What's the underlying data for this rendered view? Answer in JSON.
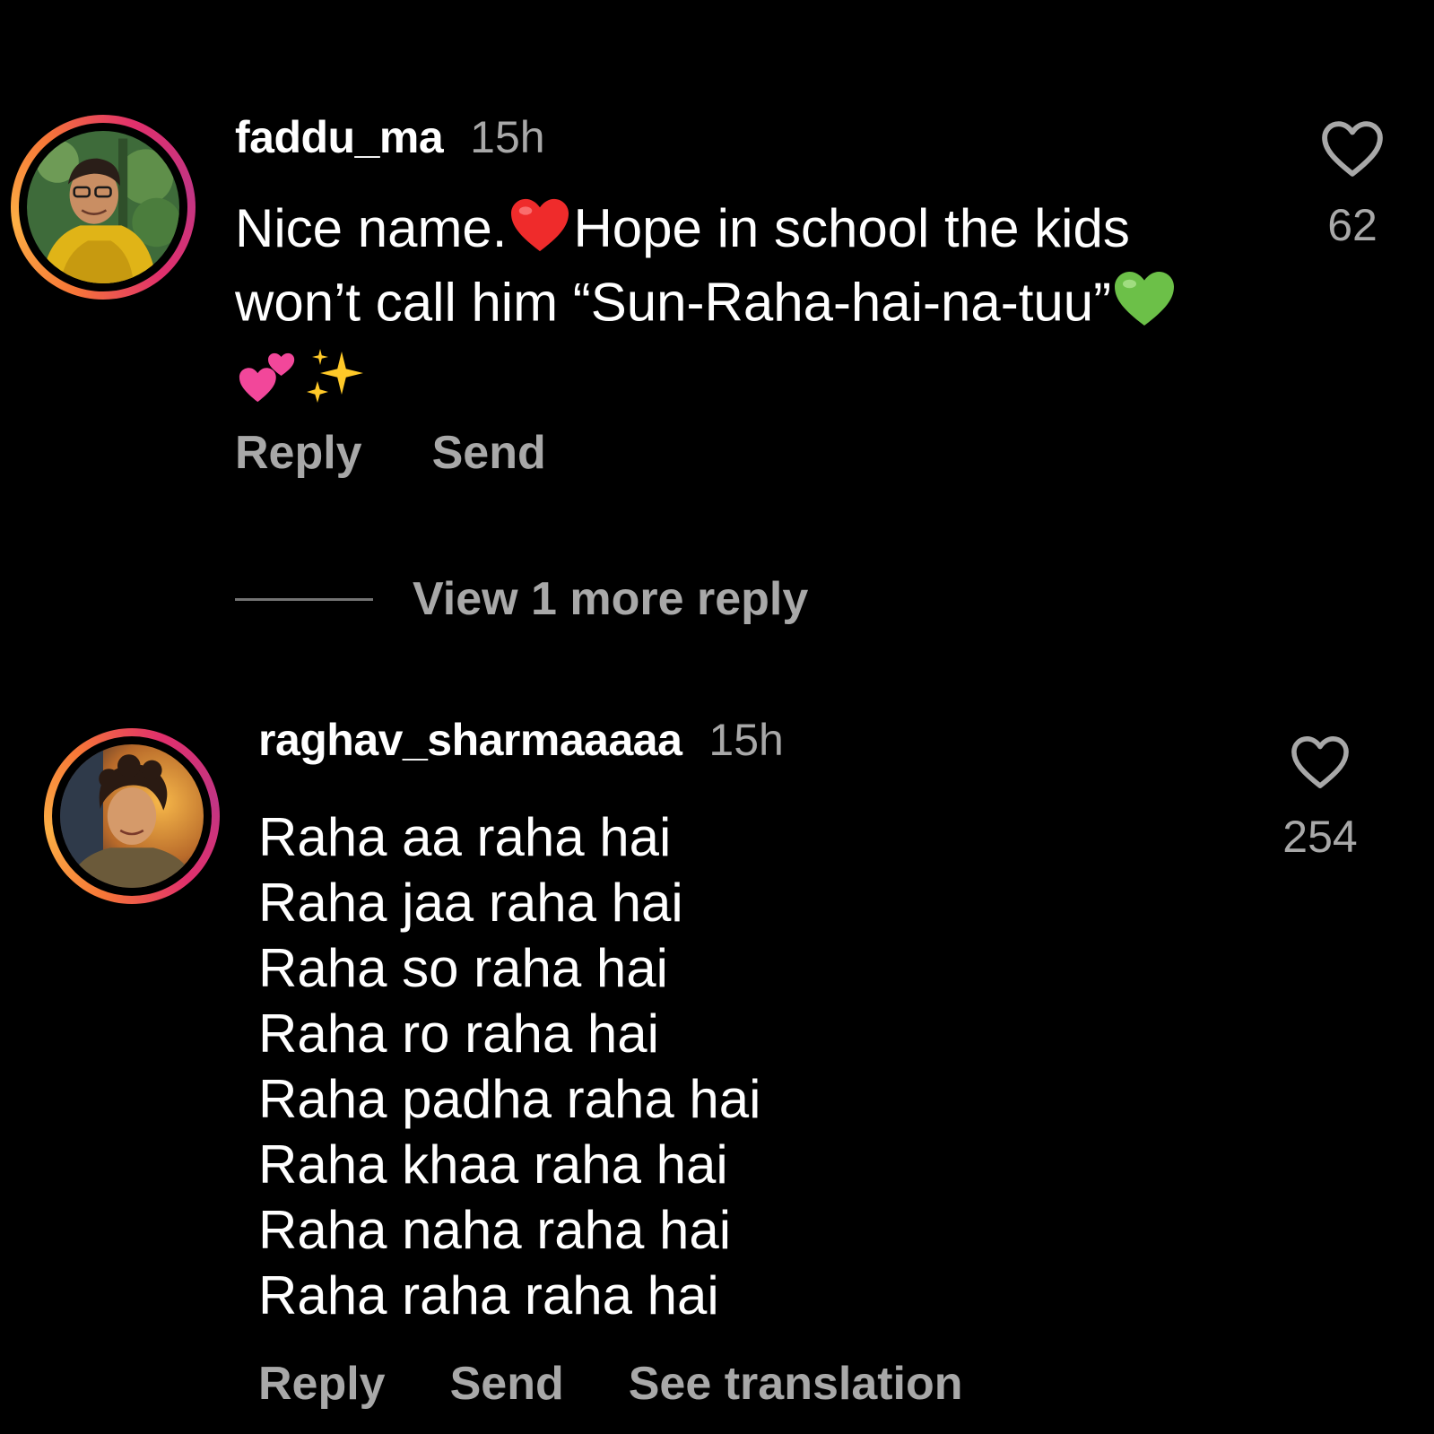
{
  "comments": [
    {
      "username": "faddu_ma",
      "time": "15h",
      "body_lines": [
        {
          "before": "Nice name.",
          "after": "Hope in school the kids"
        },
        "won’t call him “Sun-Raha-hai-na-tuu”"
      ],
      "emojis": [
        "red-heart",
        "green-heart",
        "two-hearts",
        "sparkles"
      ],
      "likes": "62",
      "actions": {
        "reply": "Reply",
        "send": "Send"
      }
    },
    {
      "username": "raghav_sharmaaaaa",
      "time": "15h",
      "body_lines": [
        "Raha aa raha hai",
        "Raha jaa raha hai",
        "Raha so raha hai",
        "Raha ro raha hai",
        "Raha padha raha hai",
        "Raha khaa raha hai",
        "Raha naha raha hai",
        "Raha raha raha hai"
      ],
      "likes": "254",
      "actions": {
        "reply": "Reply",
        "send": "Send",
        "translate": "See translation"
      }
    }
  ],
  "view_more_replies": "View 1 more reply",
  "colors": {
    "background": "#000000",
    "text": "#ffffff",
    "secondary": "#a8a8a8",
    "ring": [
      "#f77737",
      "#fcaf45",
      "#e1306c",
      "#c13584"
    ]
  }
}
